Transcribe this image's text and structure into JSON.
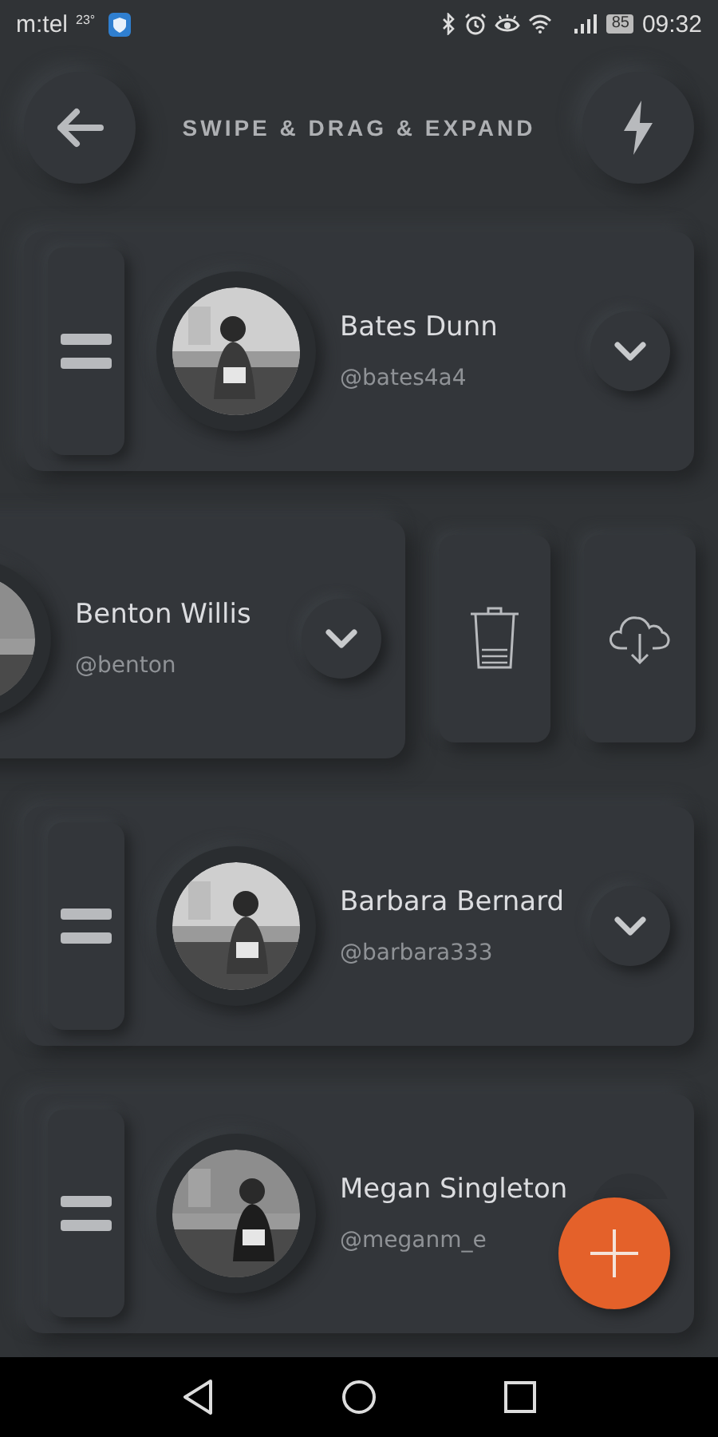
{
  "status_bar": {
    "carrier": "m:tel",
    "temperature": "23°",
    "battery": "85",
    "time": "09:32"
  },
  "header": {
    "title": "SWIPE & DRAG & EXPAND"
  },
  "cards": [
    {
      "name": "Bates Dunn",
      "handle": "@bates4a4",
      "swiped": false
    },
    {
      "name": "Benton Willis",
      "handle": "@benton",
      "swiped": true
    },
    {
      "name": "Barbara Bernard",
      "handle": "@barbara333",
      "swiped": false
    },
    {
      "name": "Megan Singleton",
      "handle": "@meganm_e",
      "swiped": false
    }
  ]
}
